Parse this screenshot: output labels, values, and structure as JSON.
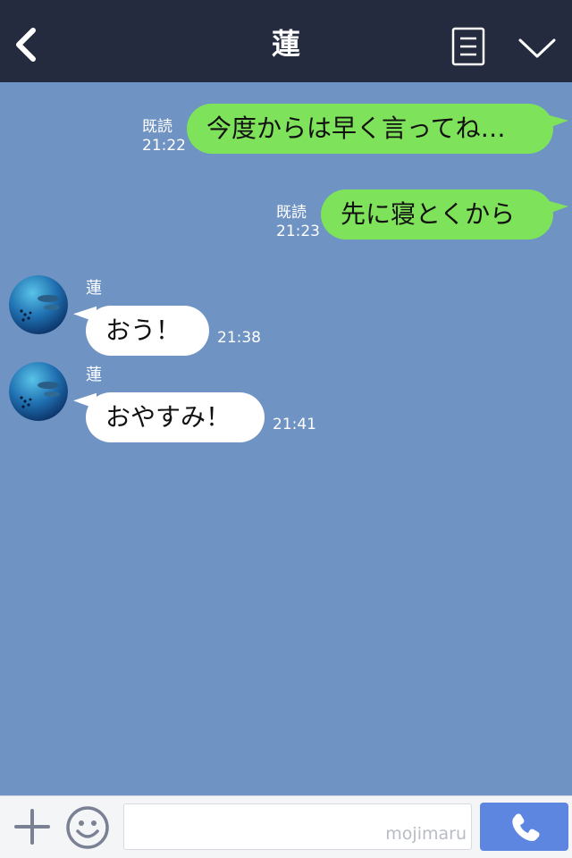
{
  "header": {
    "title": "蓮",
    "back_icon": "chevron-left-icon",
    "menu_icon": "document-menu-icon",
    "collapse_icon": "chevron-down-icon"
  },
  "messages": [
    {
      "side": "out",
      "read_label": "既読",
      "time": "21:22",
      "text": "今度からは早く言ってね…"
    },
    {
      "side": "out",
      "read_label": "既読",
      "time": "21:23",
      "text": "先に寝とくから"
    },
    {
      "side": "in",
      "sender": "蓮",
      "time": "21:38",
      "text": "おう！"
    },
    {
      "side": "in",
      "sender": "蓮",
      "time": "21:41",
      "text": "おやすみ！"
    }
  ],
  "input_bar": {
    "plus_icon": "plus-icon",
    "emoji_icon": "smiley-icon",
    "input_value": "",
    "watermark": "mojimaru",
    "call_icon": "phone-icon"
  },
  "colors": {
    "header_bg": "#242b3f",
    "chat_bg": "#6f93c2",
    "outgoing_bubble": "#7ee35a",
    "incoming_bubble": "#ffffff",
    "call_button": "#5d86e0"
  }
}
